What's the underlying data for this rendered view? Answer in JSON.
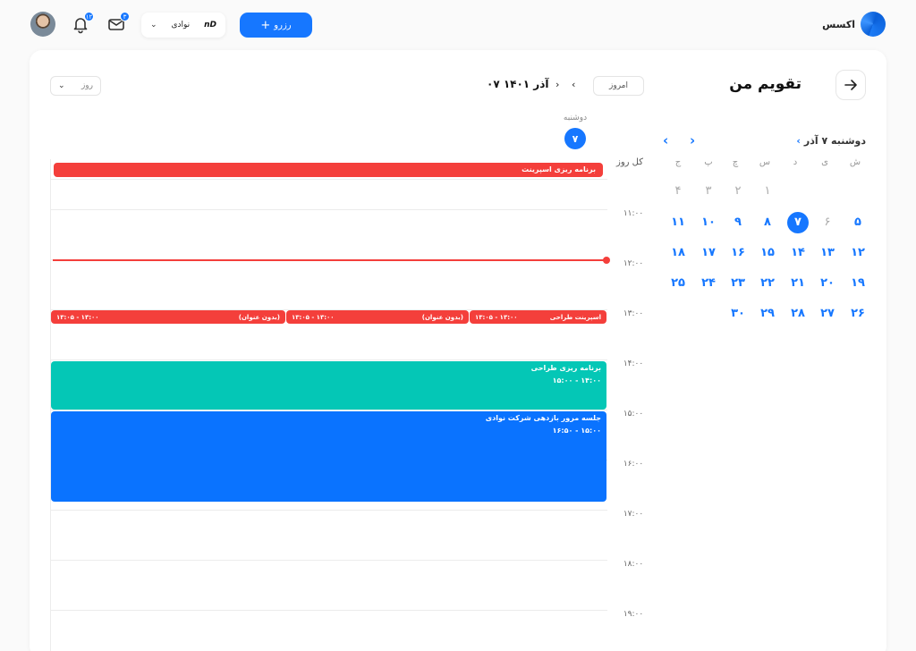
{
  "header": {
    "brand_name": "اکسس",
    "reserve_label": "رزرو",
    "workspace_logo": "nD",
    "workspace_name": "نوادی",
    "mail_badge": "۳",
    "bell_badge": "۱۲"
  },
  "page": {
    "title": "تقویم من",
    "today_label": "امروز",
    "current_date": "۰۷ آذر ۱۴۰۱",
    "view_label": "روز"
  },
  "day_header": {
    "name": "دوشنبه",
    "number": "۷"
  },
  "timeline": {
    "allday_label": "کل روز",
    "hours": [
      "۱۱:۰۰",
      "۱۲:۰۰",
      "۱۳:۰۰",
      "۱۴:۰۰",
      "۱۵:۰۰",
      "۱۶:۰۰",
      "۱۷:۰۰",
      "۱۸:۰۰",
      "۱۹:۰۰"
    ],
    "allday_event": "برنامه ریزی اسپرینت",
    "events": {
      "sprint_design": {
        "title": "اسپرینت طراحی",
        "time": "۱۳:۰۰ - ۱۳:۰۵"
      },
      "untitled_1": {
        "title": "(بدون عنوان)",
        "time": "۱۳:۰۰ - ۱۳:۰۵"
      },
      "untitled_2": {
        "title": "(بدون عنوان)",
        "time": "۱۳:۰۰ - ۱۳:۰۵"
      },
      "design_planning": {
        "title": "برنامه ریزی طراحی",
        "time": "۱۴:۰۰ - ۱۵:۰۰"
      },
      "review_meeting": {
        "title": "جلسه مرور بازدهی شرکت نوادی",
        "time": "۱۵:۰۰ - ۱۶:۵۰"
      }
    }
  },
  "mini_calendar": {
    "title": "دوشنبه ۷ آذر",
    "weekdays": [
      "ش",
      "ی",
      "د",
      "س",
      "چ",
      "پ",
      "ج"
    ],
    "rows": [
      [
        "",
        "",
        "",
        "۱",
        "۲",
        "۳",
        "۴"
      ],
      [
        "۵",
        "۶",
        "۷",
        "۸",
        "۹",
        "۱۰",
        "۱۱"
      ],
      [
        "۱۲",
        "۱۳",
        "۱۴",
        "۱۵",
        "۱۶",
        "۱۷",
        "۱۸"
      ],
      [
        "۱۹",
        "۲۰",
        "۲۱",
        "۲۲",
        "۲۳",
        "۲۴",
        "۲۵"
      ],
      [
        "۲۶",
        "۲۷",
        "۲۸",
        "۲۹",
        "۳۰",
        "",
        ""
      ]
    ]
  },
  "colors": {
    "accent": "#1677ff",
    "red": "#f43f3b",
    "teal": "#04c7b6",
    "blue": "#0a73ff"
  },
  "icons": [
    "arrow-right-icon",
    "bell-icon",
    "mail-icon",
    "plus-icon",
    "chevron-down-icon",
    "chevron-left-icon",
    "chevron-right-icon"
  ]
}
